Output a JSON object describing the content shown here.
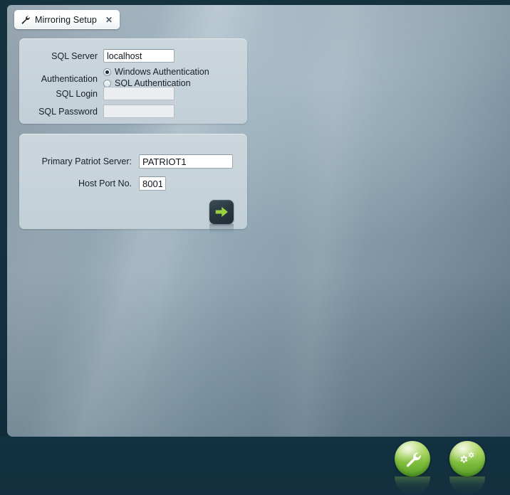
{
  "window": {
    "title": "Mirroring Setup"
  },
  "tab": {
    "label": "Mirroring Setup",
    "close_label": "✕",
    "icon": "wrench-icon"
  },
  "sql_panel": {
    "sql_server": {
      "label": "SQL Server",
      "value": "localhost",
      "placeholder": ""
    },
    "authentication": {
      "label": "Authentication",
      "options": [
        {
          "label": "Windows Authentication",
          "selected": true
        },
        {
          "label": "SQL Authentication",
          "selected": false
        }
      ]
    },
    "sql_login": {
      "label": "SQL Login",
      "value": "",
      "placeholder": "",
      "disabled": true
    },
    "sql_password": {
      "label": "SQL Password",
      "value": "",
      "placeholder": "",
      "disabled": true
    }
  },
  "server_panel": {
    "primary_patriot_server": {
      "label": "Primary Patriot Server:",
      "value": "PATRIOT1",
      "placeholder": ""
    },
    "host_port_no": {
      "label": "Host Port No.",
      "value": "8001",
      "placeholder": ""
    },
    "next_button": {
      "icon": "arrow-right-icon",
      "title": "Next"
    }
  },
  "footer_dock": {
    "buttons": [
      {
        "icon": "wrench-icon",
        "title": "Tools"
      },
      {
        "icon": "gears-icon",
        "title": "Settings"
      }
    ]
  },
  "colors": {
    "accent_green": "#8ccb45",
    "panel_fill": "#c7d3da",
    "footer_bg": "#12303f",
    "arrow_green": "#9ad13f",
    "text": "#16202a"
  }
}
